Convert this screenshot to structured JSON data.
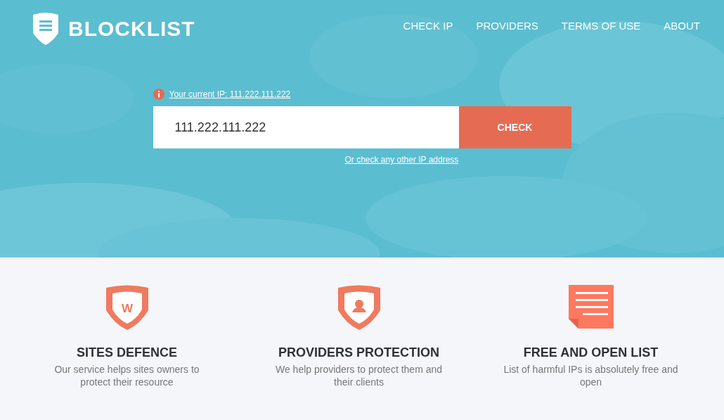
{
  "header": {
    "logo": "BLOCKLIST",
    "nav": [
      {
        "label": "CHECK IP"
      },
      {
        "label": "PROVIDERS"
      },
      {
        "label": "TERMS OF USE"
      },
      {
        "label": "ABOUT"
      }
    ]
  },
  "check_form": {
    "current_ip_link": "Your current IP: 111.222.111.222",
    "ip_field": {
      "value": "111.222.111.222"
    },
    "check_button": "CHECK",
    "other_ip_link": "Or check any other IP address"
  },
  "features": [
    {
      "kind": "shield-letter",
      "badge": "W",
      "title": "SITES DEFENCE",
      "description": "Our service helps sites owners to protect their resource"
    },
    {
      "kind": "shield-person",
      "title": "PROVIDERS PROTECTION",
      "description": "We help providers to protect them and their clients"
    },
    {
      "kind": "document",
      "title": "FREE AND OPEN LIST",
      "description": "List of harmful IPs is absolutely free and open"
    }
  ]
}
